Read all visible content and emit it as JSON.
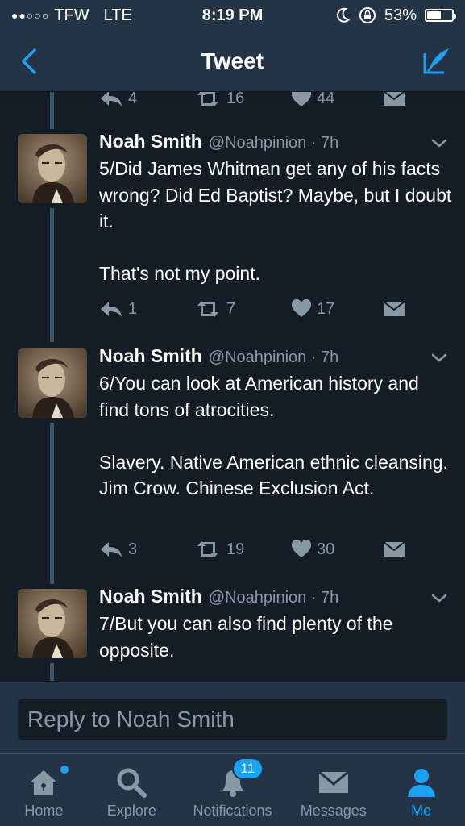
{
  "status": {
    "carrier": "TFW",
    "network": "LTE",
    "time": "8:19 PM",
    "battery": "53%",
    "battery_level": 0.53
  },
  "nav": {
    "title": "Tweet",
    "back_icon": "chevron-left-icon",
    "compose_icon": "compose-quill-icon"
  },
  "partial_actions": {
    "replies": "4",
    "retweets": "16",
    "likes": "44"
  },
  "tweets": [
    {
      "author": "Noah Smith",
      "handle": "@Noahpinion · 7h",
      "text": "5/Did James Whitman get any of his facts wrong? Did Ed Baptist? Maybe, but I doubt it.\n\nThat's not my point.",
      "replies": "1",
      "retweets": "7",
      "likes": "17"
    },
    {
      "author": "Noah Smith",
      "handle": "@Noahpinion · 7h",
      "text": "6/You can look at American history and find tons of atrocities.\n\nSlavery. Native American ethnic cleansing. Jim Crow. Chinese Exclusion Act.",
      "replies": "3",
      "retweets": "19",
      "likes": "30"
    },
    {
      "author": "Noah Smith",
      "handle": "@Noahpinion · 7h",
      "text": "7/But you can also find plenty of the opposite."
    }
  ],
  "reply": {
    "placeholder": "Reply to Noah Smith"
  },
  "tabs": [
    {
      "label": "Home",
      "icon": "home-icon"
    },
    {
      "label": "Explore",
      "icon": "search-icon"
    },
    {
      "label": "Notifications",
      "icon": "bell-icon",
      "badge": "11"
    },
    {
      "label": "Messages",
      "icon": "envelope-icon"
    },
    {
      "label": "Me",
      "icon": "person-icon"
    }
  ],
  "colors": {
    "background": "#141d26",
    "bar": "#243447",
    "accent": "#1da1f2",
    "muted": "#8899a6"
  }
}
